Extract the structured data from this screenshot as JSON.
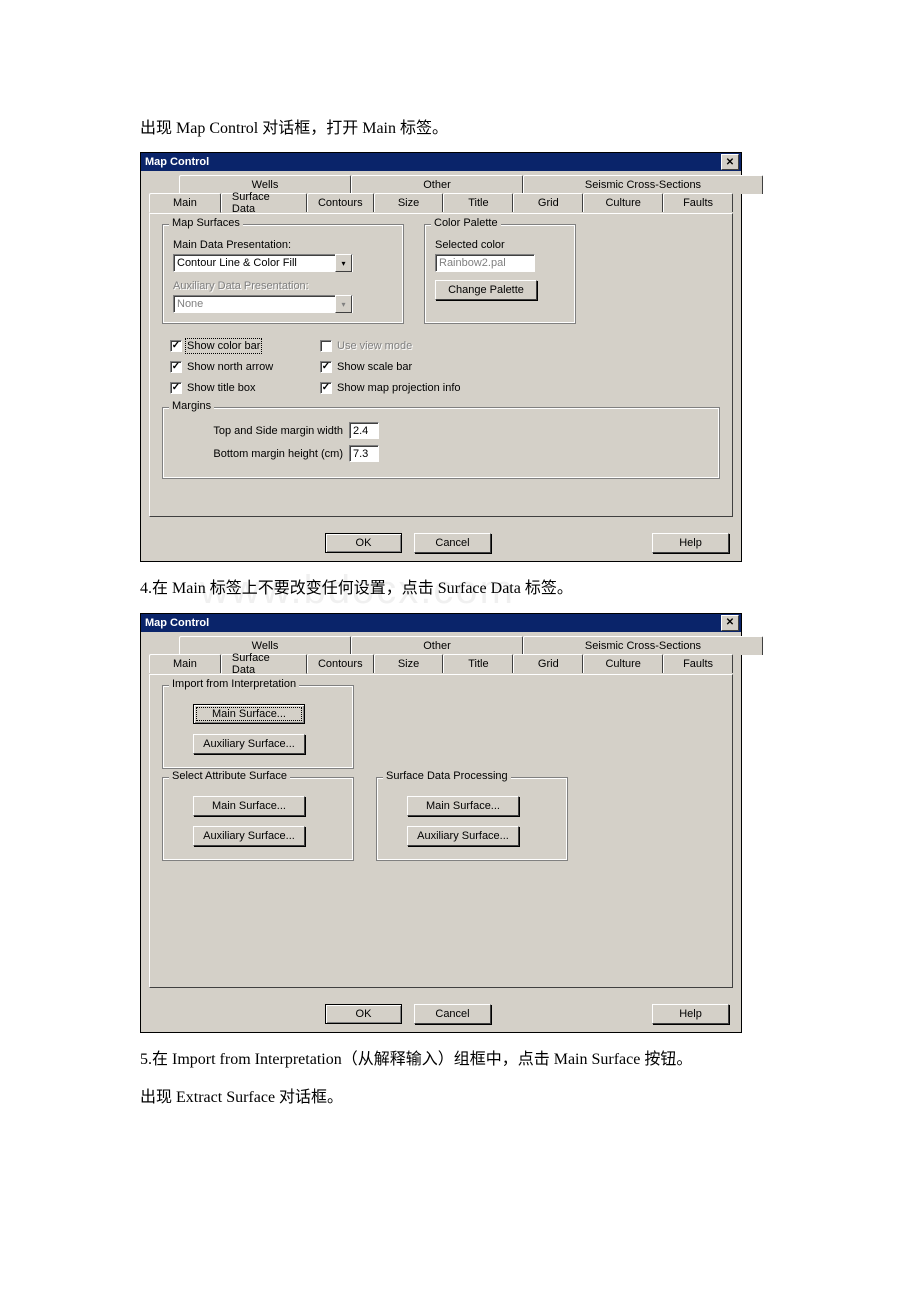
{
  "text": {
    "para1": "出现 Map Control 对话框，打开 Main 标签。",
    "para2": "4.在 Main 标签上不要改变任何设置，点击 Surface Data 标签。",
    "para3": "5.在 Import from Interpretation（从解释输入）组框中，点击 Main Surface 按钮。",
    "para4": "出现 Extract Surface 对话框。"
  },
  "dialog": {
    "title": "Map Control",
    "tabs_back": [
      "Wells",
      "Other",
      "Seismic Cross-Sections"
    ],
    "tabs_front": [
      "Main",
      "Surface Data",
      "Contours",
      "Size",
      "Title",
      "Grid",
      "Culture",
      "Faults"
    ],
    "footer": {
      "ok": "OK",
      "cancel": "Cancel",
      "help": "Help"
    }
  },
  "main_tab": {
    "map_surfaces": {
      "legend": "Map Surfaces",
      "main_pres_label": "Main Data Presentation:",
      "main_pres_value": "Contour Line & Color Fill",
      "aux_pres_label": "Auxiliary Data Presentation:",
      "aux_pres_value": "None"
    },
    "color_palette": {
      "legend": "Color Palette",
      "selected_label": "Selected color",
      "selected_value": "Rainbow2.pal",
      "change_btn": "Change Palette"
    },
    "checks": {
      "show_color_bar": "Show color bar",
      "use_view_mode": "Use view mode",
      "show_north_arrow": "Show north arrow",
      "show_scale_bar": "Show scale bar",
      "show_title_box": "Show title box",
      "show_map_proj": "Show map projection info"
    },
    "margins": {
      "legend": "Margins",
      "top_side_label": "Top and Side margin width",
      "top_side_value": "2.4",
      "bottom_label": "Bottom margin height (cm)",
      "bottom_value": "7.3"
    }
  },
  "surface_tab": {
    "import": {
      "legend": "Import from Interpretation",
      "main_btn": "Main Surface...",
      "aux_btn": "Auxiliary Surface..."
    },
    "select_attr": {
      "legend": "Select Attribute Surface",
      "main_btn": "Main Surface...",
      "aux_btn": "Auxiliary Surface..."
    },
    "processing": {
      "legend": "Surface Data Processing",
      "main_btn": "Main Surface...",
      "aux_btn": "Auxiliary Surface..."
    }
  },
  "watermark": "www.bdocx.com"
}
